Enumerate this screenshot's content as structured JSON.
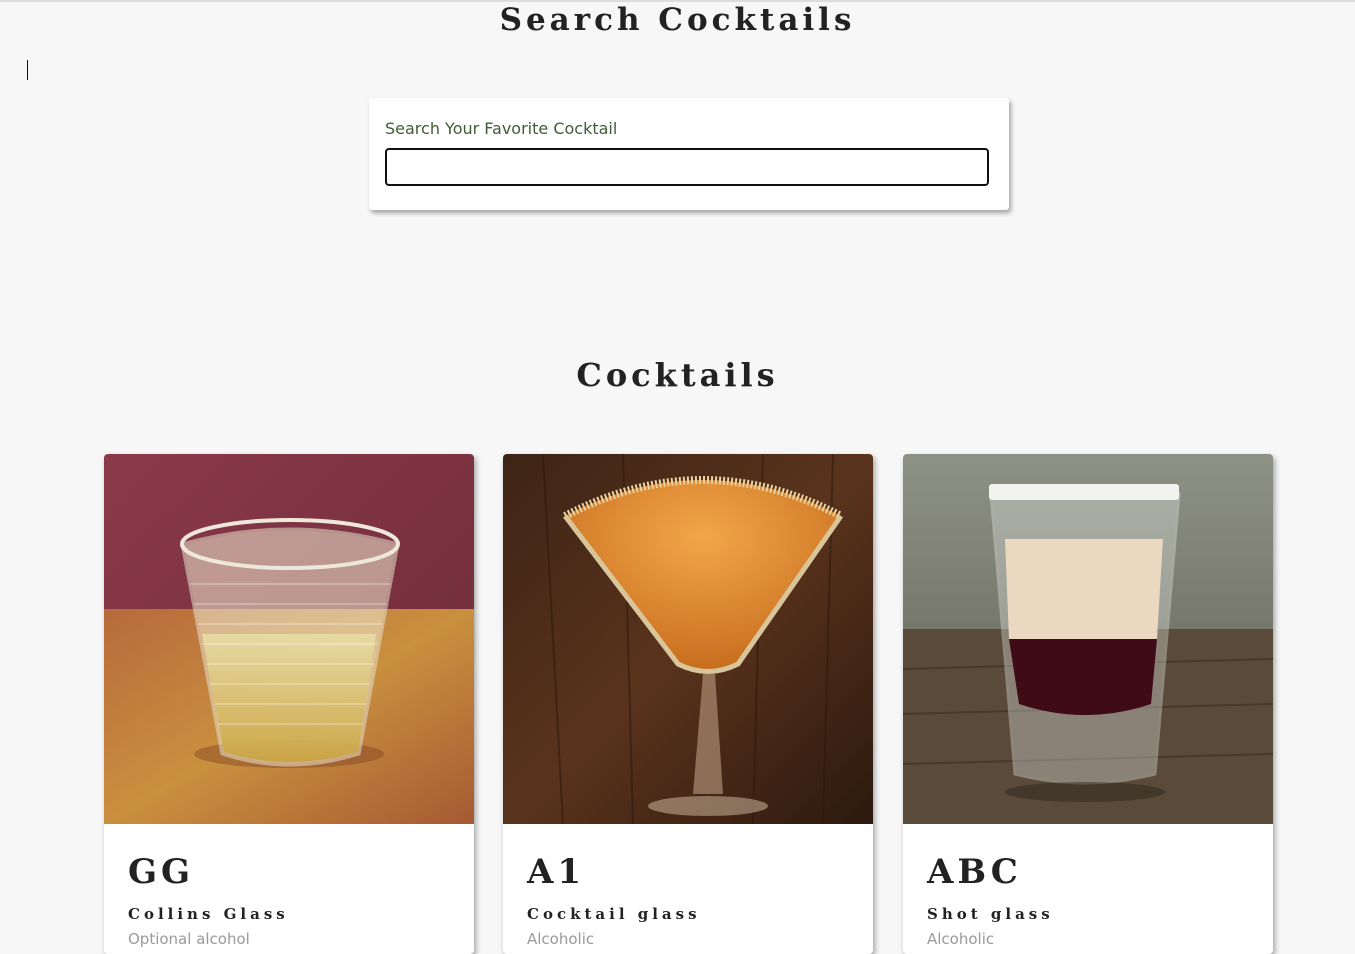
{
  "header": {
    "title": "Search Cocktails"
  },
  "search": {
    "label": "Search Your Favorite Cocktail",
    "value": "",
    "placeholder": ""
  },
  "section": {
    "title": "Cocktails"
  },
  "cocktails": [
    {
      "name": "GG",
      "glass": "Collins Glass",
      "info": "Optional alcohol"
    },
    {
      "name": "A1",
      "glass": "Cocktail glass",
      "info": "Alcoholic"
    },
    {
      "name": "ABC",
      "glass": "Shot glass",
      "info": "Alcoholic"
    }
  ],
  "colors": {
    "background": "#f7f7f7",
    "label_green": "#3f5d35",
    "text_dark": "#222222"
  }
}
